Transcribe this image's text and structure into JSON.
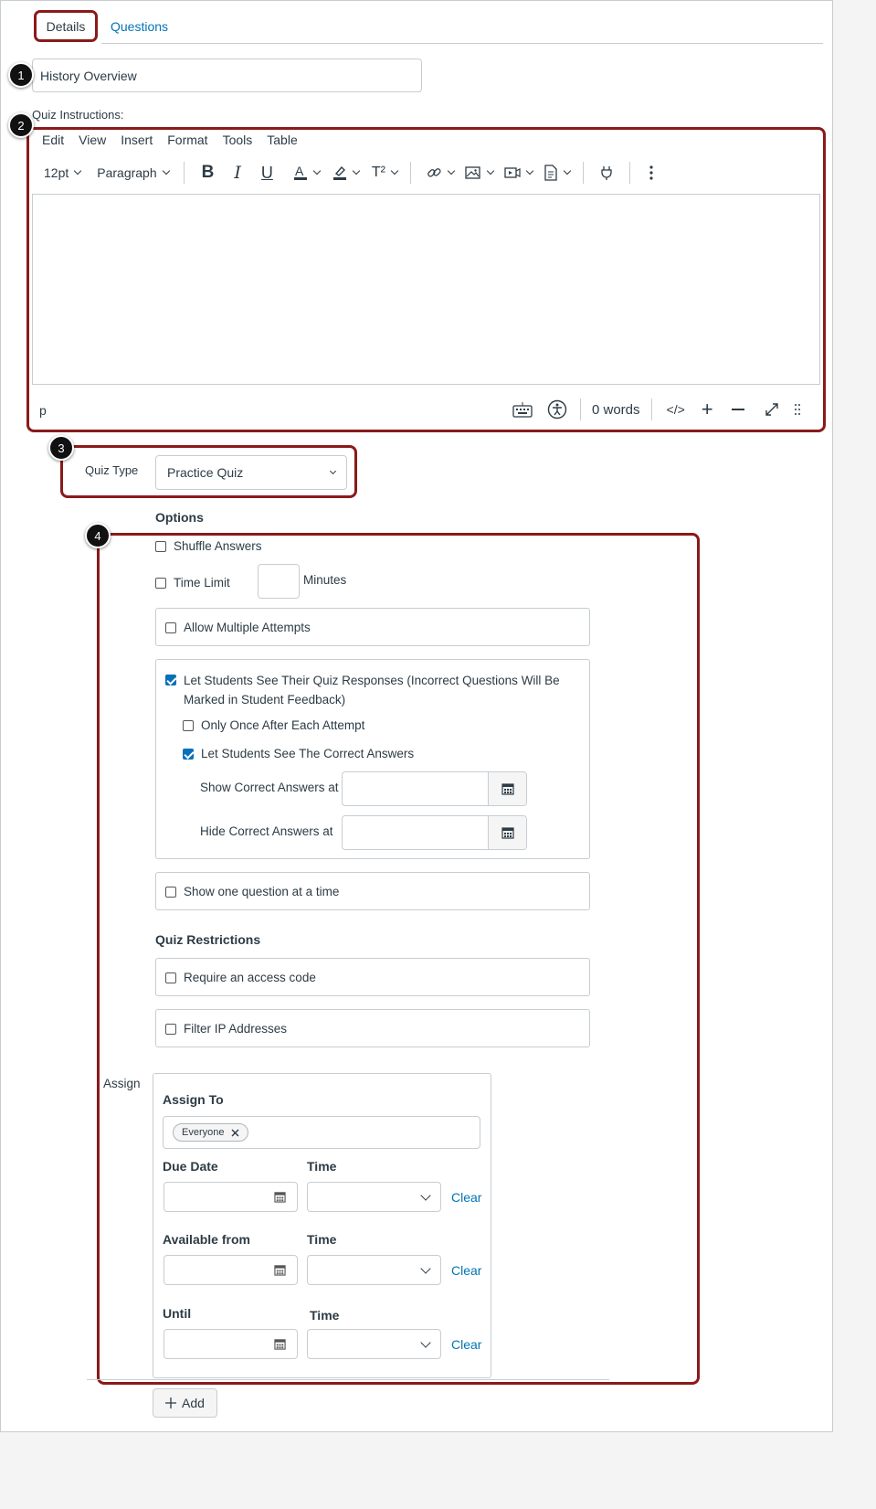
{
  "tabs": {
    "details": "Details",
    "questions": "Questions"
  },
  "badges": [
    "1",
    "2",
    "3",
    "4"
  ],
  "title_input": {
    "value": "History Overview"
  },
  "instructions_label": "Quiz Instructions:",
  "editor": {
    "menu": [
      "Edit",
      "View",
      "Insert",
      "Format",
      "Tools",
      "Table"
    ],
    "font_size": "12pt",
    "block_format": "Paragraph",
    "superscript_label": "T²",
    "status_path": "p",
    "word_count": "0 words",
    "html_toggle": "</>"
  },
  "quiz_type": {
    "label": "Quiz Type",
    "selected": "Practice Quiz"
  },
  "options": {
    "title": "Options",
    "shuffle": "Shuffle Answers",
    "time_limit": "Time Limit",
    "minutes": "Minutes",
    "multiple_attempts": "Allow Multiple Attempts",
    "see_responses": "Let Students See Their Quiz Responses (Incorrect Questions Will Be Marked in Student Feedback)",
    "only_once": "Only Once After Each Attempt",
    "see_correct": "Let Students See The Correct Answers",
    "show_correct_at": "Show Correct Answers at",
    "hide_correct_at": "Hide Correct Answers at",
    "one_question": "Show one question at a time"
  },
  "restrictions": {
    "title": "Quiz Restrictions",
    "access_code": "Require an access code",
    "filter_ip": "Filter IP Addresses"
  },
  "assign": {
    "label": "Assign",
    "assign_to": "Assign To",
    "pill": "Everyone",
    "due_date": "Due Date",
    "time": "Time",
    "available_from": "Available from",
    "until": "Until",
    "clear": "Clear",
    "add": "Add"
  },
  "colors": {
    "highlight": "#8b1a1a",
    "link": "#0374b5",
    "checkbox": "#0770b9"
  }
}
